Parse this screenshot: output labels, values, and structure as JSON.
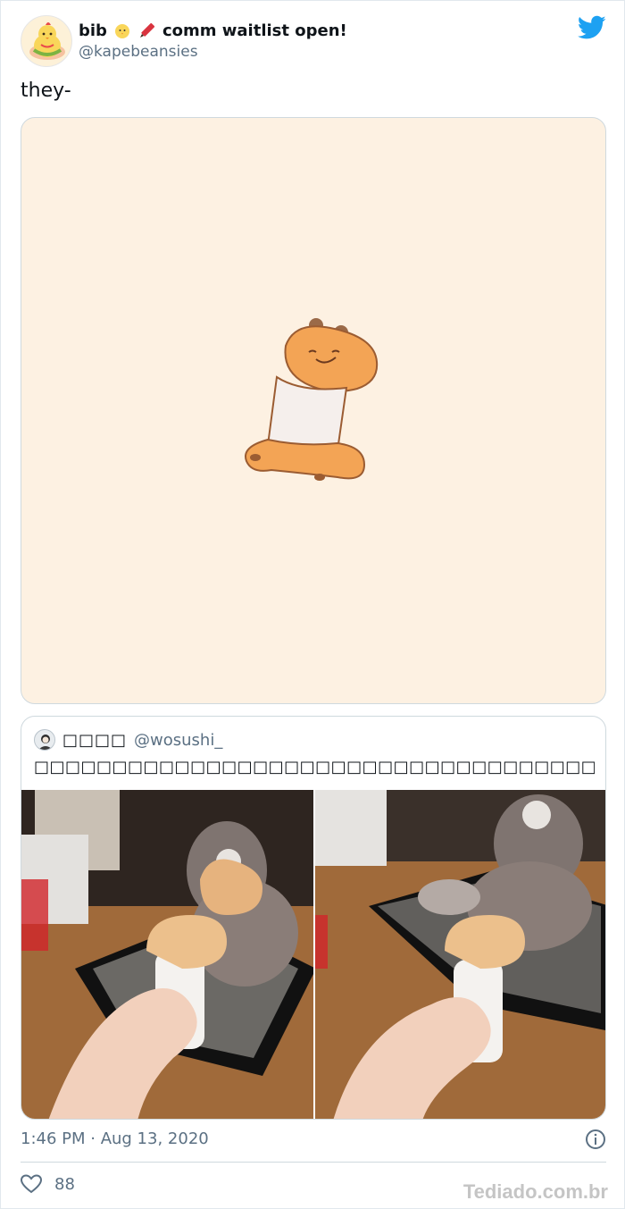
{
  "author": {
    "name_prefix": "bib",
    "name_suffix": "comm waitlist open!",
    "handle": "@kapebeansies",
    "emojis": [
      "chick-icon",
      "crayon-icon"
    ]
  },
  "tweet": {
    "text": "they-",
    "timestamp": "1:46 PM · Aug 13, 2020",
    "likes": "88"
  },
  "quoted": {
    "name": "□□□□",
    "handle": "@wosushi_",
    "text": "□□□□□□□□□□□□□□□□□□□□□□□□□□□□□□□□□□□□□□□□□□□□□□…"
  },
  "watermark": "Tediado.com.br",
  "colors": {
    "twitter_blue": "#1da1f2",
    "secondary_text": "#5b7083",
    "media_bg": "#fdf1e2",
    "border": "#cfd9de"
  }
}
